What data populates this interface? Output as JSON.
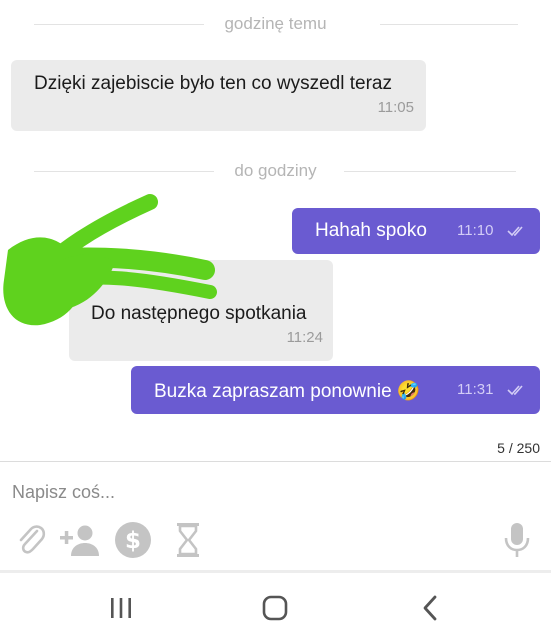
{
  "dividers": {
    "first": "godzinę temu",
    "second": "do godziny"
  },
  "messages": [
    {
      "direction": "incoming",
      "text": "Dzięki zajebiscie było ten co wyszedl teraz",
      "time": "11:05"
    },
    {
      "direction": "outgoing",
      "text": "Hahah spoko",
      "time": "11:10",
      "status": "read"
    },
    {
      "direction": "incoming",
      "text": "Do następnego spotkania",
      "time": "11:24"
    },
    {
      "direction": "outgoing",
      "text": "Buzka zapraszam ponownie 🤣",
      "time": "11:31",
      "status": "read"
    }
  ],
  "composer": {
    "char_counter": "5 / 250",
    "placeholder": "Napisz coś...",
    "tools": [
      "paperclip-icon",
      "add-person-icon",
      "dollar-icon",
      "hourglass-icon",
      "microphone-icon"
    ]
  },
  "navigation": [
    "recent-apps-icon",
    "home-icon",
    "back-icon"
  ],
  "colors": {
    "outgoing_bubble": "#6a5bd1",
    "incoming_bubble": "#ebebeb",
    "redaction_scribble": "#5fd21e",
    "icon_gray": "#c4c4c4"
  }
}
